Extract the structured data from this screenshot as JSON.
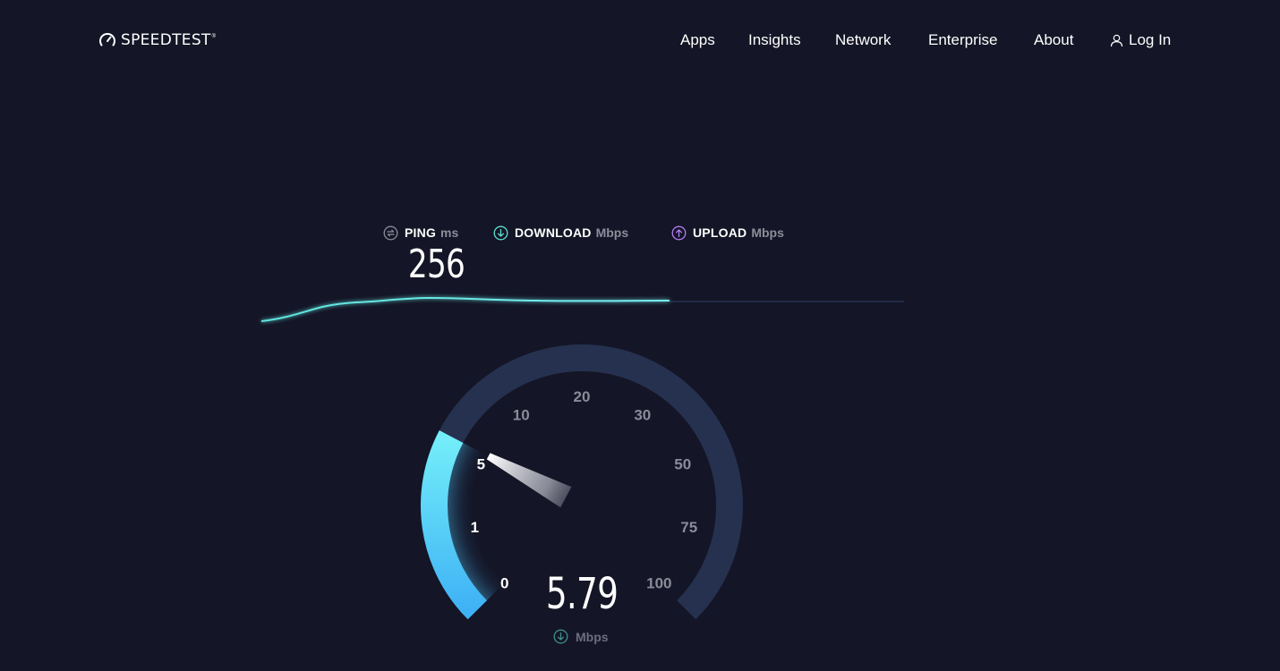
{
  "brand": {
    "name": "SPEEDTEST",
    "tm": "®"
  },
  "nav": {
    "items": [
      "Apps",
      "Insights",
      "Network",
      "Enterprise",
      "About"
    ],
    "login_label": "Log In"
  },
  "metrics": {
    "ping": {
      "label": "PING",
      "unit": "ms",
      "value": "256",
      "icon": "ping-icon"
    },
    "download": {
      "label": "DOWNLOAD",
      "unit": "Mbps",
      "icon": "download-arrow-icon"
    },
    "upload": {
      "label": "UPLOAD",
      "unit": "Mbps",
      "icon": "upload-arrow-icon"
    }
  },
  "gauge": {
    "value": "5.79",
    "value_numeric": 5.79,
    "unit": "Mbps",
    "ticks": [
      "0",
      "1",
      "5",
      "10",
      "20",
      "30",
      "50",
      "75",
      "100"
    ],
    "active_ticks": [
      "0",
      "1",
      "5"
    ]
  },
  "colors": {
    "background": "#141526",
    "accent_cyan": "#6fe7f7",
    "download_teal": "#5de0d0",
    "upload_purple": "#b67cf3",
    "gauge_track": "#25314f",
    "inactive_tick": "#8a8b98"
  }
}
